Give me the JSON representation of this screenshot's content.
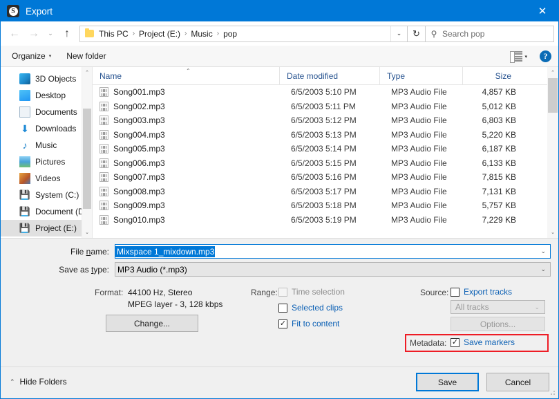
{
  "window": {
    "title": "Export",
    "icon": "app-logo-icon",
    "logo_letter": "S",
    "close_label": "✕",
    "accent_color": "#0078d7",
    "highlight_color": "#ee1c25"
  },
  "nav": {
    "back_icon": "←",
    "forward_icon": "→",
    "recent_icon": "⌄",
    "up_icon": "↑",
    "refresh_icon": "↻",
    "dropdown_icon": "⌄",
    "breadcrumb": [
      "This PC",
      "Project (E:)",
      "Music",
      "pop"
    ],
    "breadcrumb_sep": "›",
    "search": {
      "placeholder": "Search pop",
      "icon": "search-icon",
      "value": ""
    }
  },
  "command_bar": {
    "organize_label": "Organize",
    "organize_caret": "▾",
    "new_folder_label": "New folder",
    "view_caret": "▾",
    "help_label": "?"
  },
  "sidebar": {
    "items": [
      {
        "label": "3D Objects",
        "icon": "cube-icon",
        "selected": false
      },
      {
        "label": "Desktop",
        "icon": "desktop-icon",
        "selected": false
      },
      {
        "label": "Documents",
        "icon": "document-icon",
        "selected": false
      },
      {
        "label": "Downloads",
        "icon": "download-arrow-icon",
        "selected": false
      },
      {
        "label": "Music",
        "icon": "music-note-icon",
        "selected": false
      },
      {
        "label": "Pictures",
        "icon": "picture-icon",
        "selected": false
      },
      {
        "label": "Videos",
        "icon": "video-icon",
        "selected": false
      },
      {
        "label": "System (C:)",
        "icon": "hard-drive-icon",
        "selected": false
      },
      {
        "label": "Document (D:)",
        "icon": "hard-drive-icon",
        "selected": false
      },
      {
        "label": "Project (E:)",
        "icon": "hard-drive-icon",
        "selected": true
      }
    ],
    "scroll_up_icon": "⌃",
    "scroll_down_icon": "⌄"
  },
  "file_list": {
    "columns": [
      "Name",
      "Date modified",
      "Type",
      "Size"
    ],
    "sort_indicator": "⌃",
    "rows": [
      {
        "name": "Song001.mp3",
        "date": "6/5/2003 5:10 PM",
        "type": "MP3 Audio File",
        "size": "4,857 KB"
      },
      {
        "name": "Song002.mp3",
        "date": "6/5/2003 5:11 PM",
        "type": "MP3 Audio File",
        "size": "5,012 KB"
      },
      {
        "name": "Song003.mp3",
        "date": "6/5/2003 5:12 PM",
        "type": "MP3 Audio File",
        "size": "6,803 KB"
      },
      {
        "name": "Song004.mp3",
        "date": "6/5/2003 5:13 PM",
        "type": "MP3 Audio File",
        "size": "5,220 KB"
      },
      {
        "name": "Song005.mp3",
        "date": "6/5/2003 5:14 PM",
        "type": "MP3 Audio File",
        "size": "6,187 KB"
      },
      {
        "name": "Song006.mp3",
        "date": "6/5/2003 5:15 PM",
        "type": "MP3 Audio File",
        "size": "6,133 KB"
      },
      {
        "name": "Song007.mp3",
        "date": "6/5/2003 5:16 PM",
        "type": "MP3 Audio File",
        "size": "7,815 KB"
      },
      {
        "name": "Song008.mp3",
        "date": "6/5/2003 5:17 PM",
        "type": "MP3 Audio File",
        "size": "7,131 KB"
      },
      {
        "name": "Song009.mp3",
        "date": "6/5/2003 5:18 PM",
        "type": "MP3 Audio File",
        "size": "5,757 KB"
      },
      {
        "name": "Song010.mp3",
        "date": "6/5/2003 5:19 PM",
        "type": "MP3 Audio File",
        "size": "7,229 KB"
      }
    ],
    "scroll_up_icon": "⌃",
    "scroll_down_icon": "⌄"
  },
  "form": {
    "file_name_label": "File name:",
    "file_name_value": "Mixspace 1_mixdown.mp3",
    "save_as_type_label": "Save as type:",
    "save_as_type_value": "MP3 Audio (*.mp3)",
    "dropdown_icon": "⌄"
  },
  "options": {
    "format_label": "Format:",
    "format_line1": "44100 Hz, Stereo",
    "format_line2": "MPEG layer - 3, 128 kbps",
    "change_button": "Change...",
    "range_label": "Range:",
    "range_items": [
      {
        "label": "Time selection",
        "checked": false,
        "disabled": true
      },
      {
        "label": "Selected clips",
        "checked": false,
        "disabled": false
      },
      {
        "label": "Fit to content",
        "checked": true,
        "disabled": false
      }
    ],
    "source_label": "Source:",
    "export_tracks_label": "Export tracks",
    "export_tracks_checked": false,
    "tracks_dropdown_value": "All tracks",
    "tracks_dropdown_icon": "⌄",
    "options_button": "Options...",
    "metadata_label": "Metadata:",
    "save_markers_label": "Save markers",
    "save_markers_checked": true,
    "check_glyph": "✓"
  },
  "footer": {
    "hide_folders_label": "Hide Folders",
    "hide_folders_caret": "⌃",
    "save_button": "Save",
    "cancel_button": "Cancel"
  }
}
